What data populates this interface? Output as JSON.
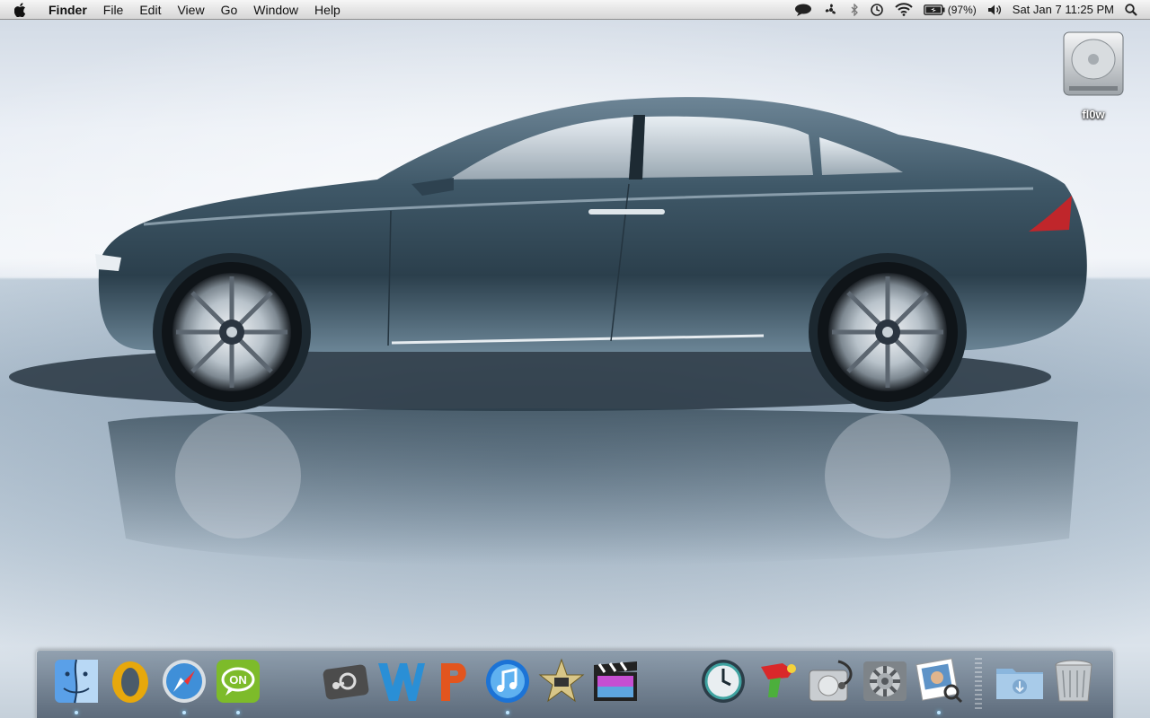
{
  "menubar": {
    "apple_icon": "apple-logo-icon",
    "app_name": "Finder",
    "menus": [
      "File",
      "Edit",
      "View",
      "Go",
      "Window",
      "Help"
    ],
    "status_icons": [
      "chat-bubble-icon",
      "fan-icon",
      "bluetooth-icon",
      "time-machine-icon",
      "wifi-icon",
      "battery-icon",
      "volume-icon",
      "spotlight-icon"
    ],
    "battery_percent": "(97%)",
    "clock": "Sat Jan 7  11:25 PM"
  },
  "desktop": {
    "wallpaper": "silver-blue sedan side view on reflective floor",
    "icons": [
      {
        "label": "fl0w",
        "icon": "hard-drive-icon"
      }
    ]
  },
  "dock": {
    "items": [
      {
        "name": "finder",
        "icon": "finder-icon",
        "running": true
      },
      {
        "name": "opera",
        "icon": "opera-icon",
        "running": false
      },
      {
        "name": "safari",
        "icon": "safari-icon",
        "running": true
      },
      {
        "name": "chat",
        "icon": "on-chat-icon",
        "running": true
      },
      {
        "name": "steam",
        "icon": "steam-icon",
        "running": false
      },
      {
        "name": "word",
        "icon": "word-icon",
        "running": false
      },
      {
        "name": "powerpoint",
        "icon": "powerpoint-icon",
        "running": false
      },
      {
        "name": "itunes",
        "icon": "itunes-icon",
        "running": true
      },
      {
        "name": "imovie",
        "icon": "imovie-icon",
        "running": false
      },
      {
        "name": "final-cut",
        "icon": "final-cut-icon",
        "running": false
      },
      {
        "name": "time-machine",
        "icon": "time-machine-icon",
        "running": false
      },
      {
        "name": "ray-gun",
        "icon": "ray-gun-icon",
        "running": false
      },
      {
        "name": "disk-utility",
        "icon": "disk-utility-icon",
        "running": false
      },
      {
        "name": "system-preferences",
        "icon": "system-preferences-icon",
        "running": false
      },
      {
        "name": "preview",
        "icon": "preview-icon",
        "running": true
      },
      {
        "name": "downloads",
        "icon": "downloads-folder-icon",
        "running": false
      },
      {
        "name": "trash",
        "icon": "trash-icon",
        "running": false
      }
    ]
  },
  "colors": {
    "car_body": "#3d5566",
    "dock_glow": "#7fd0ff"
  }
}
